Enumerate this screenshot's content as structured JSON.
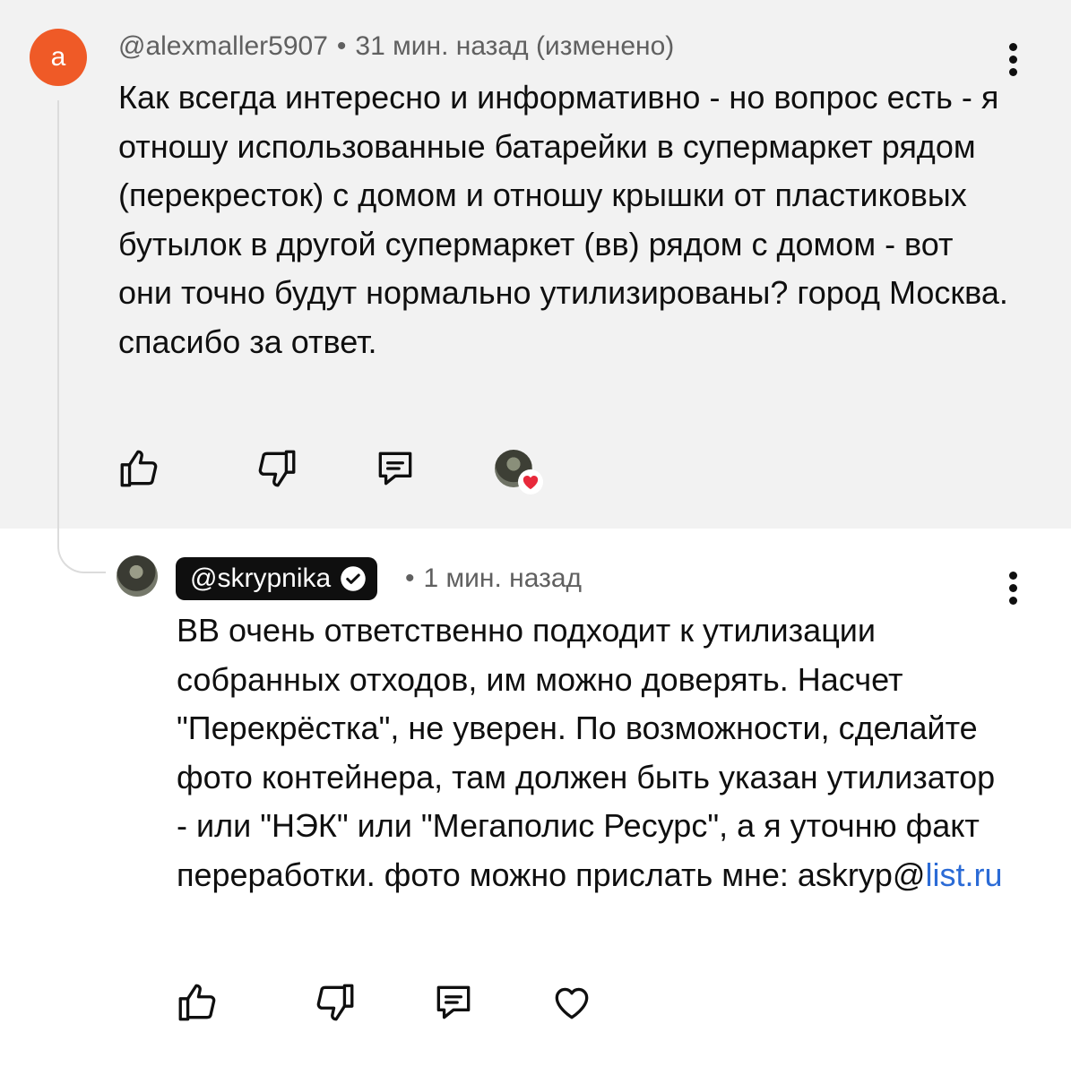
{
  "parent_comment": {
    "avatar_letter": "a",
    "author": "@alexmaller5907",
    "separator": "•",
    "time": "31 мин. назад (изменено)",
    "text": "Как всегда интересно и информативно - но вопрос есть - я отношу использованные батарейки в супермаркет рядом (перекресток) с домом и отношу крышки от пластиковых бутылок в другой супермаркет (вв) рядом с домом - вот они точно будут нормально утилизированы? город Москва. спасибо за ответ.",
    "actions": [
      "like-icon",
      "dislike-icon",
      "reply-icon",
      "creator-heart"
    ]
  },
  "reply": {
    "author": "@skrypnika",
    "separator": "•",
    "time": "1 мин. назад",
    "text_main": "ВВ очень ответственно подходит к утилизации собранных отходов, им можно доверять. Насчет \"Перекрёстка\", не уверен. По возможности, сделайте фото контейнера, там должен быть указан утилизатор - или \"НЭК\" или \"Мегаполис Ресурс\", а я уточню факт переработки. фото можно прислать мне: askryp@",
    "text_link": "list.ru",
    "actions": [
      "like-icon",
      "dislike-icon",
      "reply-icon",
      "heart-icon"
    ]
  },
  "colors": {
    "highlight_bg": "#f2f2f2",
    "avatar_orange": "#ef5a27",
    "link_blue": "#2b6bd6",
    "heart_red": "#e8293b"
  }
}
